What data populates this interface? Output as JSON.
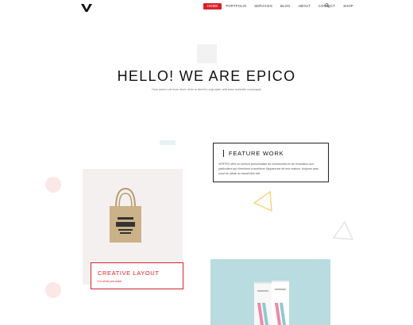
{
  "nav": {
    "items": [
      {
        "label": "Home",
        "active": true
      },
      {
        "label": "Portfolio",
        "active": false
      },
      {
        "label": "Services",
        "active": false
      },
      {
        "label": "Blog",
        "active": false
      },
      {
        "label": "About",
        "active": false
      },
      {
        "label": "Contact",
        "active": false
      },
      {
        "label": "Shop",
        "active": false
      }
    ],
    "search_icon": "search-icon",
    "logo_icon": "v-logo-icon",
    "accent": "#d8232a"
  },
  "hero": {
    "title": "HELLO! WE ARE EPICO",
    "subtitle": "Duis autem vel eum iriure dolor in dreril in vulputate velit esse molestie consequat"
  },
  "feature": {
    "title": "FEATURE WORK",
    "text": "VERTEX offre un service personnalisé de construction et de rénovation aux particuliers qui cherchent à améliorer l'apparence de leur maison, toujours avec souci du détail du travail bien fait."
  },
  "creative": {
    "title": "CREATIVE LAYOUT",
    "subtitle": "Do what you want"
  },
  "colors": {
    "teal": "#b9dce0",
    "pink": "#fbe8e6",
    "yellow": "#f3d57a",
    "card_bg": "#f4f0f0"
  }
}
